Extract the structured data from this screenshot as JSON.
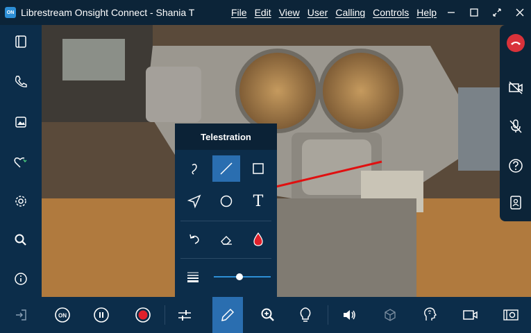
{
  "window": {
    "logo_text": "ON",
    "title": "Librestream Onsight Connect - Shania T"
  },
  "menu": [
    "File",
    "Edit",
    "View",
    "User",
    "Calling",
    "Controls",
    "Help"
  ],
  "sidebar_icons": [
    "panel-toggle-icon",
    "phone-icon",
    "gallery-icon",
    "favorites-icon",
    "settings-gear-icon",
    "search-icon",
    "info-icon",
    "exit-icon"
  ],
  "right_rail_icons": [
    "end-call-icon",
    "video-off-icon",
    "mic-off-icon",
    "help-icon",
    "contact-card-icon"
  ],
  "telestration": {
    "title": "Telestration",
    "text_tool_glyph": "T",
    "line_width_level": 0.45
  },
  "toolbar_icons": [
    "on-icon",
    "pause-icon",
    "record-icon",
    "adjust-icon",
    "pencil-icon",
    "zoom-in-icon",
    "lightbulb-icon",
    "speaker-icon",
    "3d-box-icon",
    "voice-assist-icon",
    "camera-icon",
    "snapshot-icon"
  ],
  "toolbar": {
    "on_label": "ON"
  },
  "colors": {
    "accent": "#2a6eb0",
    "end_call": "#d9323a",
    "record": "#e1202b",
    "telestration_line": "#e01010"
  }
}
